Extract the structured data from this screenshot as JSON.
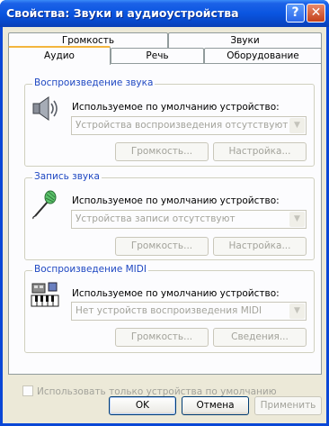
{
  "window": {
    "title": "Свойства: Звуки и аудиоустройства",
    "help_glyph": "?",
    "close_glyph": "✕"
  },
  "tabs": {
    "back_row": [
      "Громкость",
      "Звуки"
    ],
    "front_row": [
      "Аудио",
      "Речь",
      "Оборудование"
    ],
    "active": "Аудио"
  },
  "playback": {
    "label": "Воспроизведение звука",
    "device_label": "Используемое по умолчанию устройство:",
    "device_value": "Устройства воспроизведения отсутствуют",
    "btn_volume": "Громкость...",
    "btn_settings": "Настройка...",
    "icon": "speaker-icon"
  },
  "recording": {
    "label": "Запись звука",
    "device_label": "Используемое по умолчанию устройство:",
    "device_value": "Устройства записи отсутствуют",
    "btn_volume": "Громкость...",
    "btn_settings": "Настройка...",
    "icon": "microphone-icon"
  },
  "midi": {
    "label": "Воспроизведение MIDI",
    "device_label": "Используемое по умолчанию устройство:",
    "device_value": "Нет устройств воспроизведения MIDI",
    "btn_volume": "Громкость...",
    "btn_info": "Сведения...",
    "icon": "midi-keyboard-icon"
  },
  "only_default_label": "Использовать только устройства по умолчанию",
  "footer": {
    "ok": "OK",
    "cancel": "Отмена",
    "apply": "Применить"
  },
  "colors": {
    "titlebar": "#0a55e0",
    "group_label": "#1f48c2",
    "dialog_bg": "#ece9d8",
    "active_tab_accent": "#f3b53e"
  }
}
